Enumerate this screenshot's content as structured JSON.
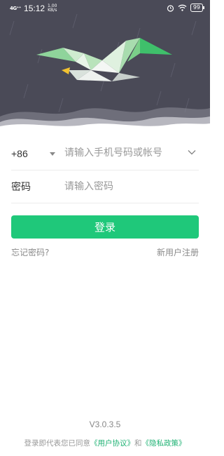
{
  "status_bar": {
    "signal": "4G⁺⁺",
    "time": "15:12",
    "speed_value": "1.00",
    "speed_unit": "KB/s",
    "alarm_icon": "alarm-icon",
    "wifi_icon": "wifi-icon",
    "battery": "99"
  },
  "form": {
    "country_code": "+86",
    "phone_placeholder": "请输入手机号码或帐号",
    "password_label": "密码",
    "password_placeholder": "请输入密码"
  },
  "actions": {
    "login": "登录",
    "forgot_password": "忘记密码?",
    "register": "新用户注册"
  },
  "footer": {
    "version": "V3.0.3.5",
    "agreement_prefix": "登录即代表您已同意",
    "user_agreement": "《用户协议》",
    "and": "和",
    "privacy_policy": "《隐私政策》"
  },
  "colors": {
    "accent": "#1fc87a",
    "hero_bg": "#4a4a57",
    "link": "#1fb274"
  }
}
